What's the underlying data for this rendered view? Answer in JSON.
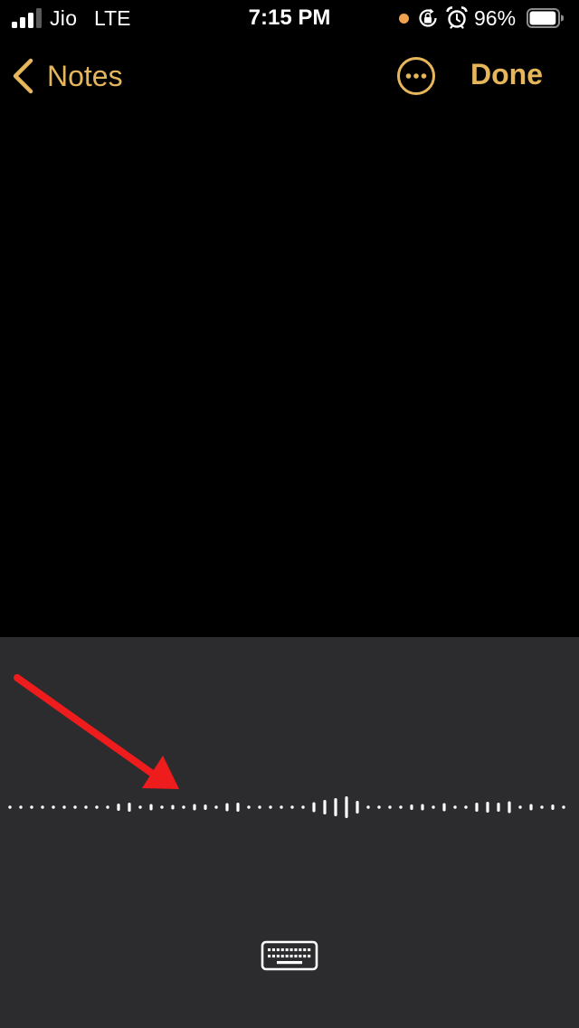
{
  "status_bar": {
    "carrier": "Jio",
    "network": "LTE",
    "time": "7:15 PM",
    "battery_percent": "96%",
    "signal_bars_active": 3,
    "signal_bars_total": 4,
    "battery_level": 0.96,
    "icons": [
      "signal-icon",
      "mic-in-use-dot",
      "rotation-lock-icon",
      "alarm-icon",
      "battery-icon"
    ],
    "colors": {
      "text": "#ffffff",
      "mic_dot": "#f0a250"
    }
  },
  "nav": {
    "back_label": "Notes",
    "done_label": "Done",
    "more_icon": "ellipsis-circle-icon",
    "back_icon": "chevron-left-icon",
    "accent_color": "#e5b65a"
  },
  "dictation": {
    "panel_color": "#2c2c2e",
    "keyboard_icon": "keyboard-icon",
    "annotation": "red-arrow"
  }
}
